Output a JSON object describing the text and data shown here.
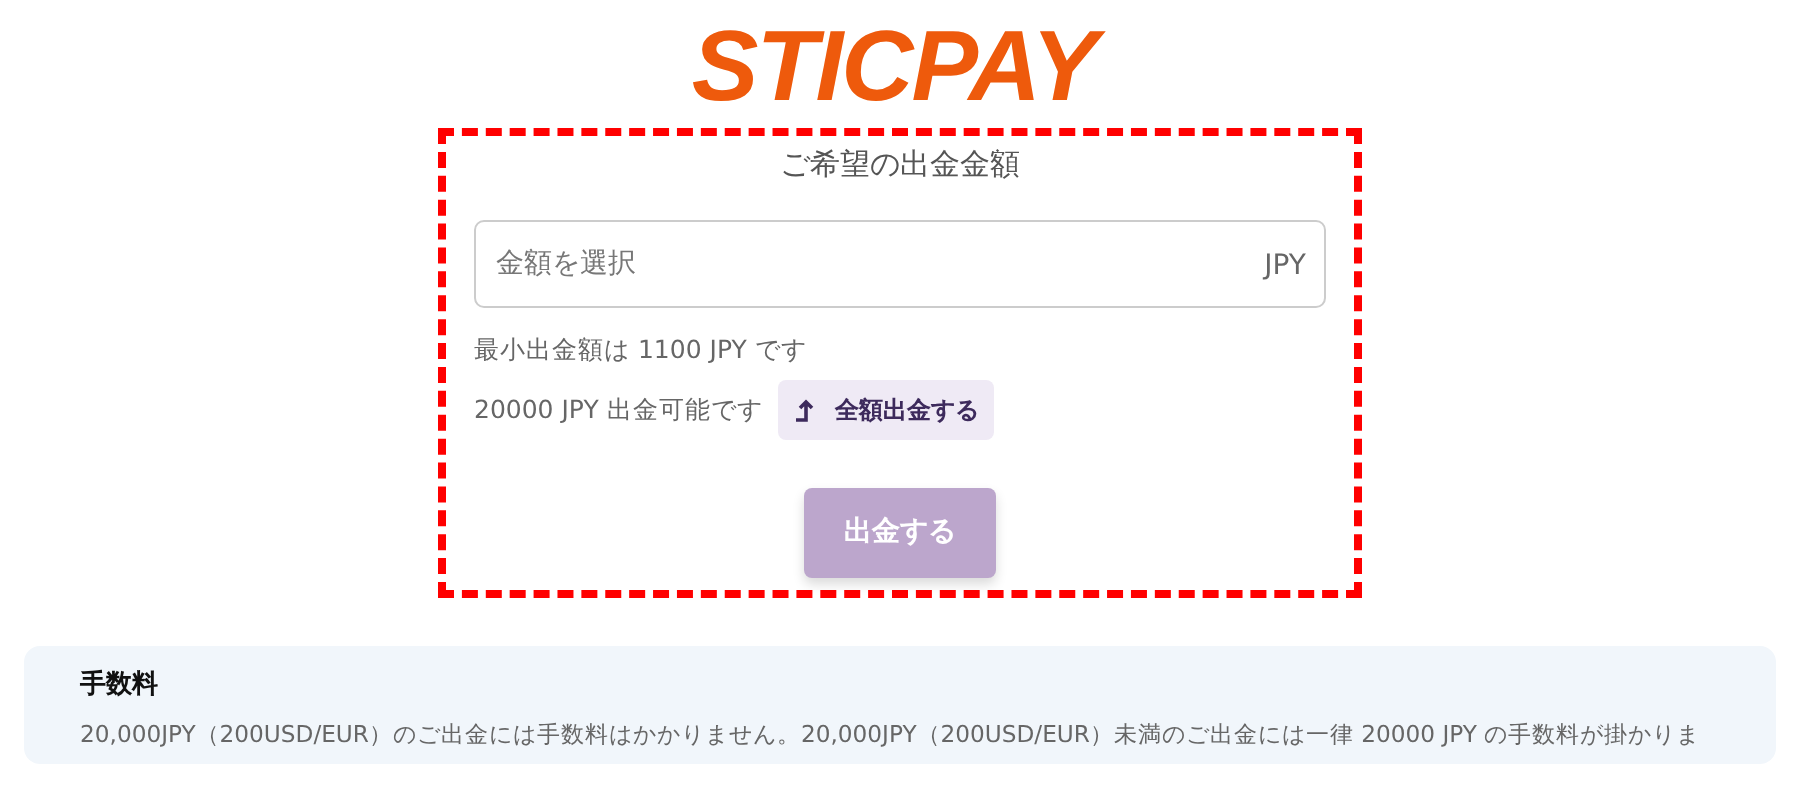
{
  "logo": "STICPAY",
  "form": {
    "title": "ご希望の出金金額",
    "amount_field": {
      "placeholder": "金額を選択",
      "currency": "JPY"
    },
    "minimum_note": "最小出金額は 1100 JPY です",
    "available_note": "20000 JPY 出金可能です",
    "withdraw_all_button": "全額出金する",
    "submit_button": {
      "label": "出金する",
      "disabled": true
    }
  },
  "fees": {
    "title": "手数料",
    "text": "20,000JPY（200USD/EUR）のご出金には手数料はかかりません。20,000JPY（200USD/EUR）未満のご出金には一律 20000 JPY の手数料が掛かりま"
  }
}
